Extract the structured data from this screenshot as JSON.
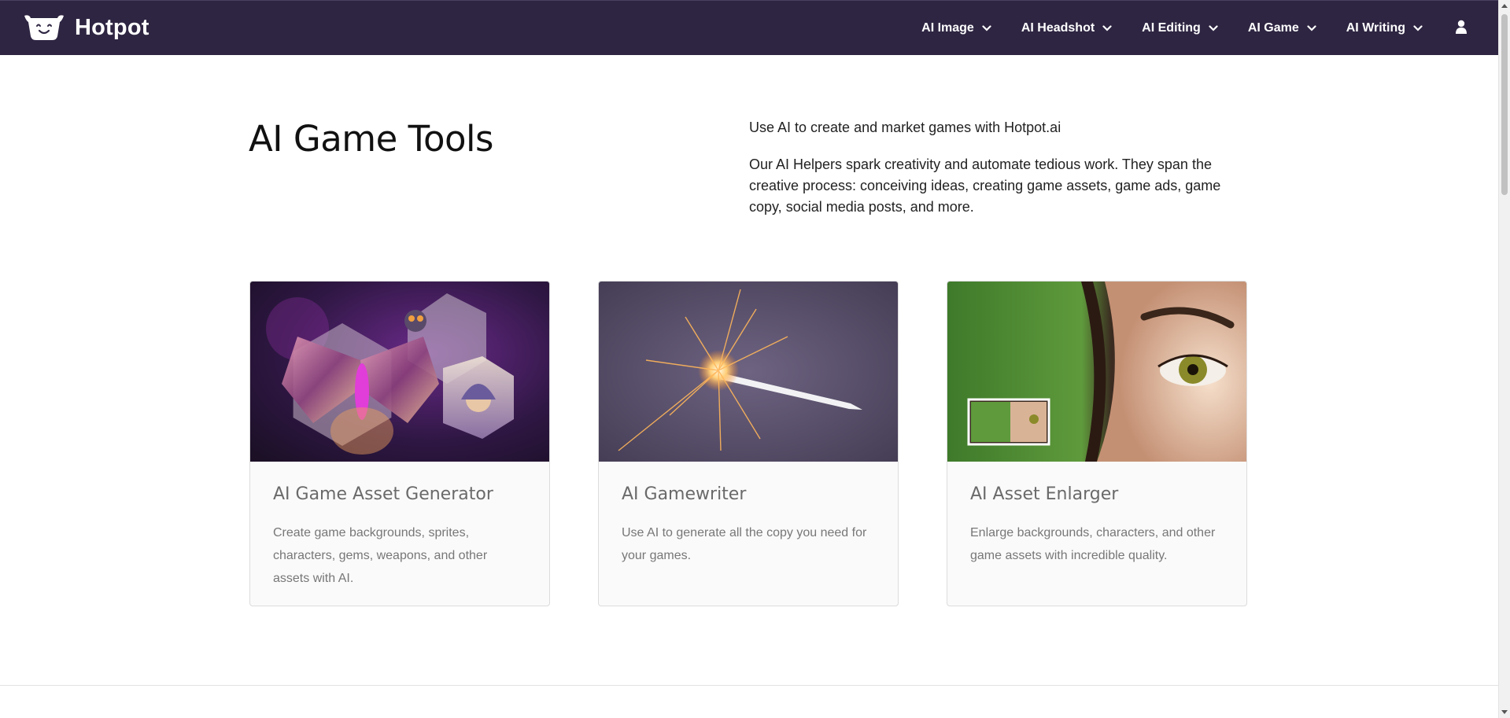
{
  "brand": {
    "name": "Hotpot",
    "logo_icon": "smiling-pot-logo"
  },
  "nav": {
    "items": [
      {
        "label": "AI Image"
      },
      {
        "label": "AI Headshot"
      },
      {
        "label": "AI Editing"
      },
      {
        "label": "AI Game"
      },
      {
        "label": "AI Writing"
      }
    ],
    "user_icon": "user-icon"
  },
  "hero": {
    "title": "AI Game Tools",
    "subtitle": "Use AI to create and market games with Hotpot.ai",
    "description": "Our AI Helpers spark creativity and automate tedious work. They span the creative process: conceiving ideas, creating game assets, game ads, game copy, social media posts, and more."
  },
  "cards": [
    {
      "title": "AI Game Asset Generator",
      "description": "Create game backgrounds, sprites, characters, gems, weapons, and other assets with AI.",
      "image": "fantasy-moth-owl-hexagons"
    },
    {
      "title": "AI Gamewriter",
      "description": "Use AI to generate all the copy you need for your games.",
      "image": "sparkler-pen"
    },
    {
      "title": "AI Asset Enlarger",
      "description": "Enlarge backgrounds, characters, and other game assets with incredible quality.",
      "image": "eye-closeup-enlarge"
    }
  ],
  "colors": {
    "topbar": "#2e2542",
    "accent": "#ffffff",
    "card_title": "#6a6a6a",
    "card_text": "#777777"
  }
}
